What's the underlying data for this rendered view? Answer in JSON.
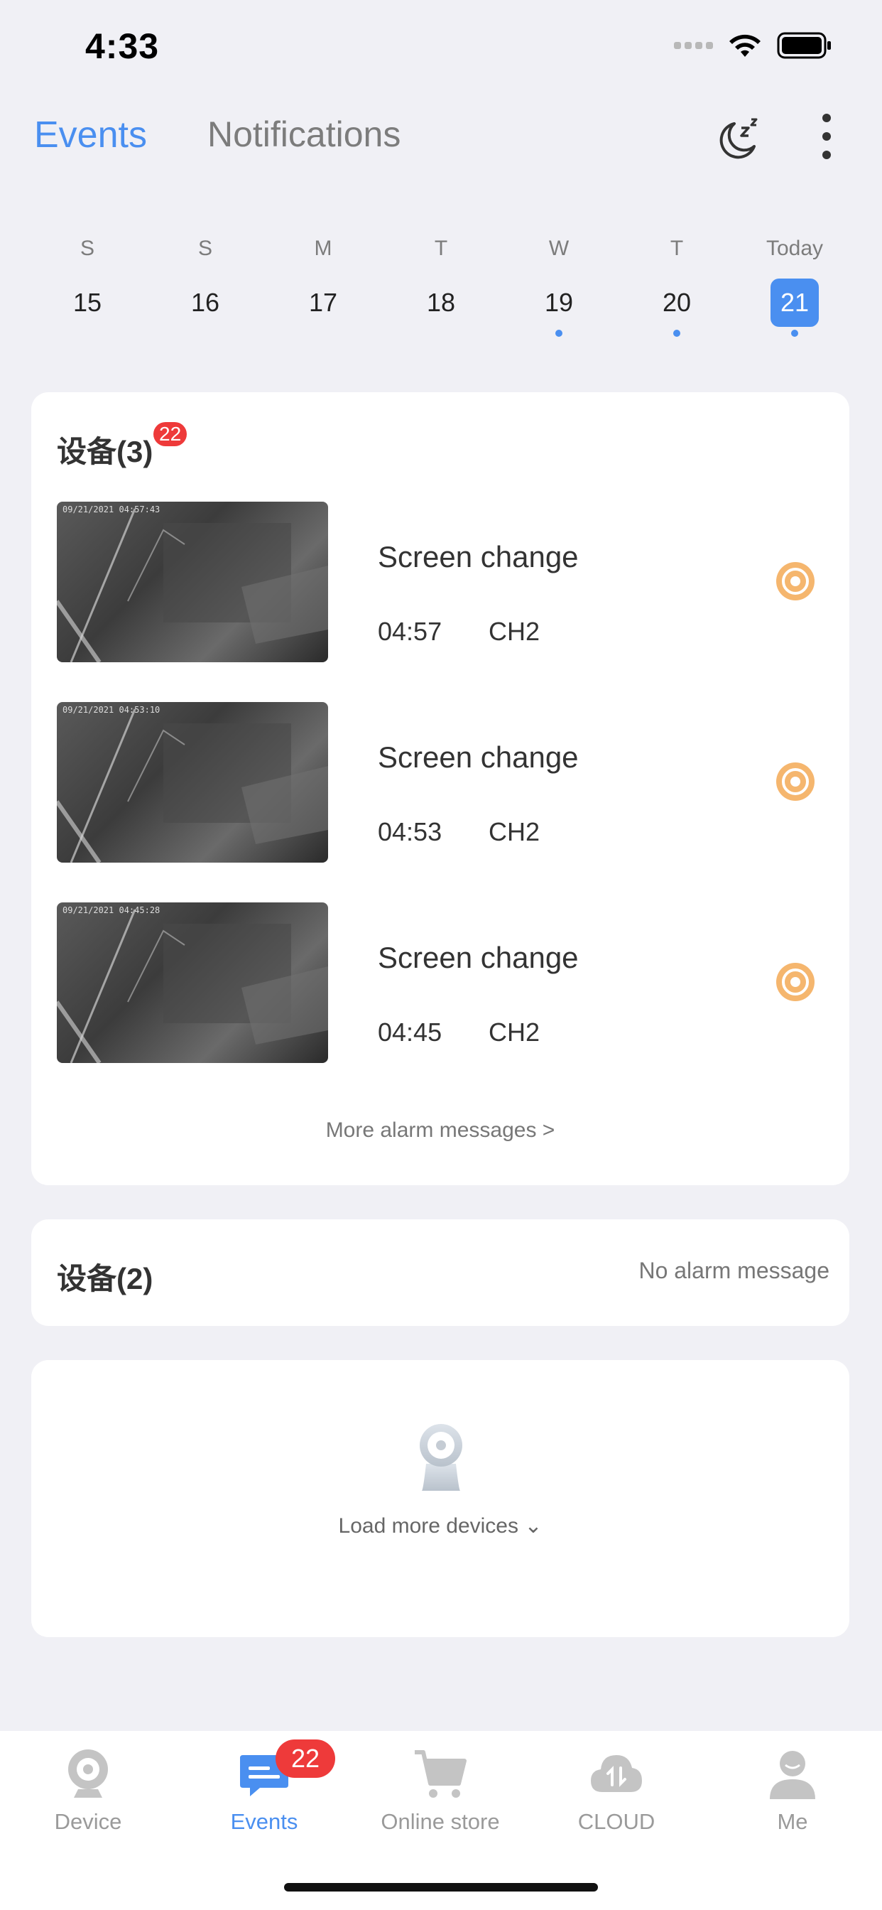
{
  "status": {
    "time": "4:33"
  },
  "header": {
    "tab_events": "Events",
    "tab_notifications": "Notifications"
  },
  "calendar": {
    "days": [
      {
        "dow": "S",
        "num": "15"
      },
      {
        "dow": "S",
        "num": "16"
      },
      {
        "dow": "M",
        "num": "17"
      },
      {
        "dow": "T",
        "num": "18"
      },
      {
        "dow": "W",
        "num": "19"
      },
      {
        "dow": "T",
        "num": "20"
      },
      {
        "dow": "Today",
        "num": "21"
      }
    ]
  },
  "group1": {
    "title": "设备(3)",
    "badge": "22",
    "events": [
      {
        "title": "Screen change",
        "time": "04:57",
        "channel": "CH2",
        "stamp": "09/21/2021 04:57:43"
      },
      {
        "title": "Screen change",
        "time": "04:53",
        "channel": "CH2",
        "stamp": "09/21/2021 04:53:10"
      },
      {
        "title": "Screen change",
        "time": "04:45",
        "channel": "CH2",
        "stamp": "09/21/2021 04:45:28"
      }
    ],
    "more": "More alarm messages >"
  },
  "group2": {
    "title": "设备(2)",
    "status": "No alarm message"
  },
  "load_more": "Load more devices ⌄",
  "tabbar": {
    "device": "Device",
    "events": "Events",
    "events_badge": "22",
    "store": "Online store",
    "cloud": "CLOUD",
    "me": "Me"
  },
  "colors": {
    "accent": "#4a8ff0",
    "badge": "#ee3a3a",
    "alarm": "#f5b66e"
  }
}
